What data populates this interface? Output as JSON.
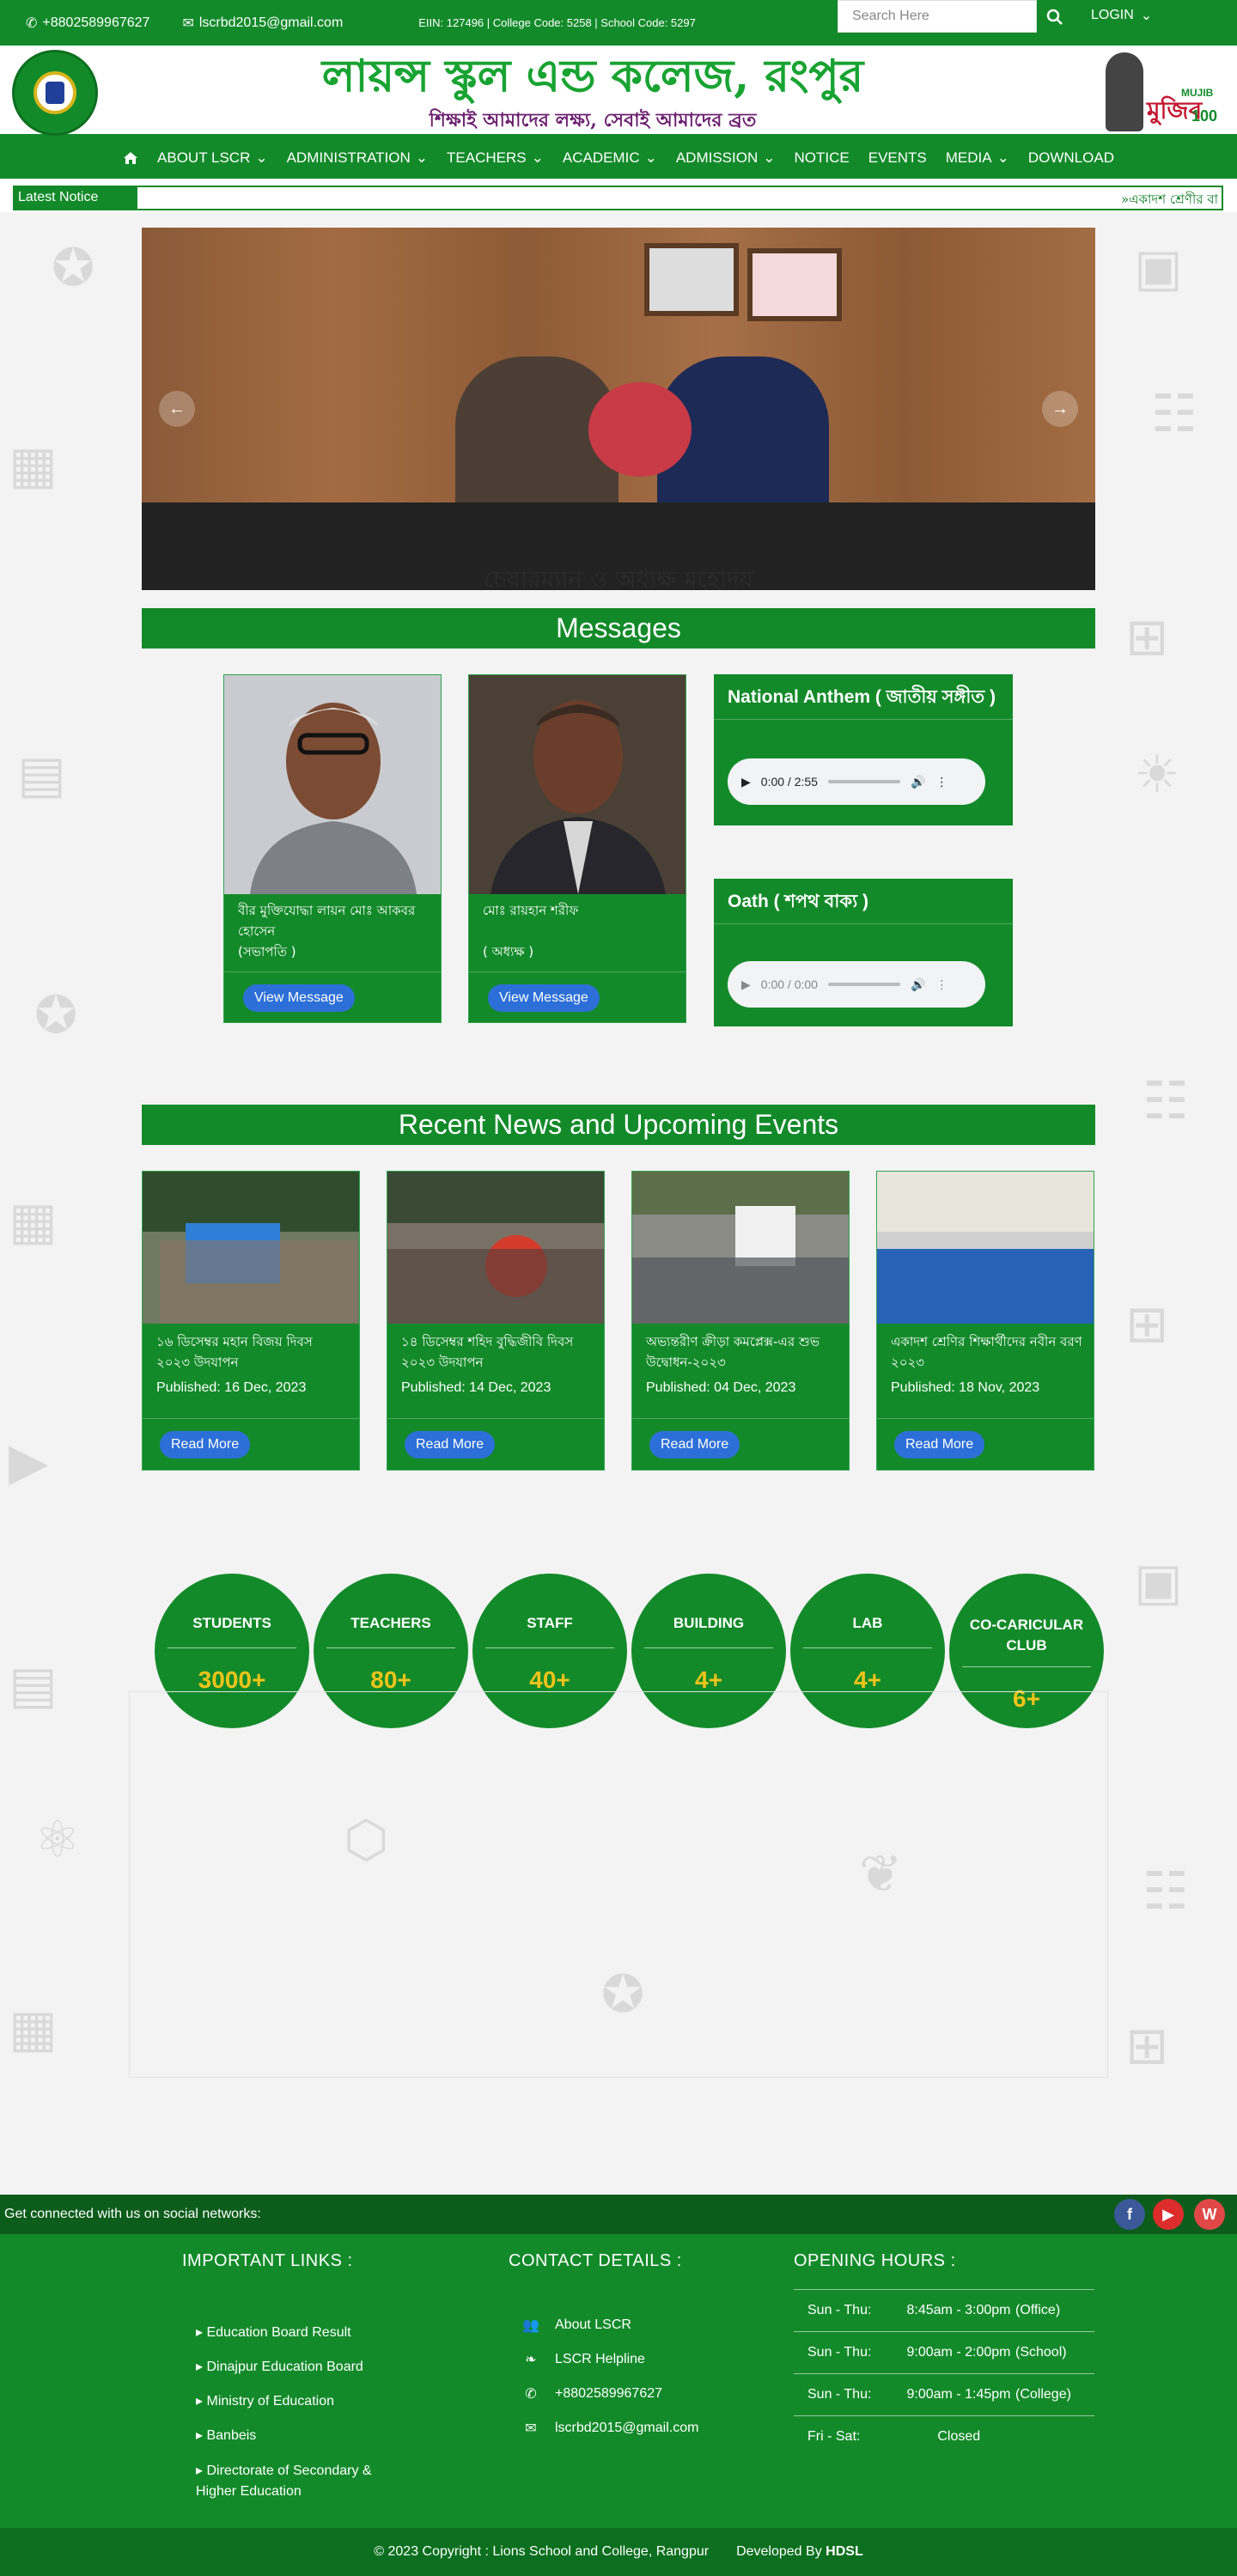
{
  "topbar": {
    "phone": "+8802589967627",
    "email": "lscrbd2015@gmail.com",
    "codes": "EIIN: 127496 | College Code: 5258 | School Code: 5297",
    "search_placeholder": "Search Here",
    "login": "LOGIN"
  },
  "header": {
    "school_name": "লায়ন্স স্কুল এন্ড কলেজ, রংপুর",
    "tagline": "শিক্ষাই আমাদের লক্ষ্য, সেবাই আমাদের ব্রত",
    "banner_text": "মুজিব",
    "banner_sub": "MUJIB",
    "banner_num": "100"
  },
  "nav": {
    "items": [
      "ABOUT LSCR",
      "ADMINISTRATION",
      "TEACHERS",
      "ACADEMIC",
      "ADMISSION",
      "NOTICE",
      "EVENTS",
      "MEDIA",
      "DOWNLOAD"
    ]
  },
  "notice": {
    "label": "Latest Notice",
    "ticker": "একাদশ শ্রেণীর বা"
  },
  "slider": {
    "caption": "চেয়ারম্যান ও অধ্যক্ষ মহোদয়"
  },
  "messages": {
    "title": "Messages",
    "people": [
      {
        "name": "বীর মুক্তিযোদ্ধা লায়ন মোঃ আকবর হোসেন",
        "role": "(সভাপতি )",
        "button": "View Message"
      },
      {
        "name": "মোঃ রায়হান শরীফ",
        "role": "( অধ্যক্ষ )",
        "button": "View Message"
      }
    ],
    "anthem": {
      "title": "National Anthem ( জাতীয় সঙ্গীত )",
      "time": "0:00 / 2:55"
    },
    "oath": {
      "title": "Oath ( শপথ বাক্য )",
      "time": "0:00 / 0:00"
    }
  },
  "news": {
    "title": "Recent News and Upcoming Events",
    "items": [
      {
        "title": "১৬ ডিসেম্বর মহান বিজয় দিবস ২০২৩ উদযাপন",
        "date": "Published: 16 Dec, 2023",
        "button": "Read More"
      },
      {
        "title": "১৪ ডিসেম্বর শহিদ বুদ্ধিজীবি দিবস ২০২৩ উদযাপন",
        "date": "Published: 14 Dec, 2023",
        "button": "Read More"
      },
      {
        "title": "অভ্যন্তরীণ ক্রীড়া কমপ্লেক্স-এর শুভ উদ্বোধন-২০২৩",
        "date": "Published: 04 Dec, 2023",
        "button": "Read More"
      },
      {
        "title": "একাদশ শ্রেণির শিক্ষার্থীদের নবীন বরণ ২০২৩",
        "date": "Published: 18 Nov, 2023",
        "button": "Read More"
      }
    ]
  },
  "stats": [
    {
      "label": "STUDENTS",
      "value": "3000+"
    },
    {
      "label": "TEACHERS",
      "value": "80+"
    },
    {
      "label": "STAFF",
      "value": "40+"
    },
    {
      "label": "BUILDING",
      "value": "4+"
    },
    {
      "label": "LAB",
      "value": "4+"
    },
    {
      "label": "CO-CARICULAR CLUB",
      "value": "6+"
    }
  ],
  "social": {
    "text": "Get connected with us on social networks:",
    "icons": [
      "facebook-icon",
      "youtube-icon",
      "website-icon"
    ]
  },
  "footer": {
    "links_title": "IMPORTANT LINKS :",
    "links": [
      "Education Board Result",
      "Dinajpur Education Board",
      "Ministry of Education",
      "Banbeis",
      "Directorate of Secondary & Higher Education"
    ],
    "contact_title": "CONTACT DETAILS :",
    "contacts": [
      "About LSCR",
      "LSCR Helpline",
      "+8802589967627",
      "lscrbd2015@gmail.com"
    ],
    "hours_title": "OPENING HOURS :",
    "hours": [
      {
        "days": "Sun - Thu:",
        "time": "8:45am - 3:00pm",
        "who": "(Office)"
      },
      {
        "days": "Sun - Thu:",
        "time": "9:00am - 2:00pm",
        "who": "(School)"
      },
      {
        "days": "Sun - Thu:",
        "time": "9:00am - 1:45pm",
        "who": "(College)"
      },
      {
        "days": "Fri - Sat:",
        "time": "Closed",
        "who": ""
      }
    ],
    "copyright": "© 2023 Copyright : Lions School and College, Rangpur",
    "developed_by": "Developed By",
    "developer": "HDSL"
  },
  "colors": {
    "primary_green": "#138a2a",
    "dark_green": "#0c6f1f",
    "button_blue": "#2d6fd8",
    "stat_yellow": "#f0c419"
  }
}
